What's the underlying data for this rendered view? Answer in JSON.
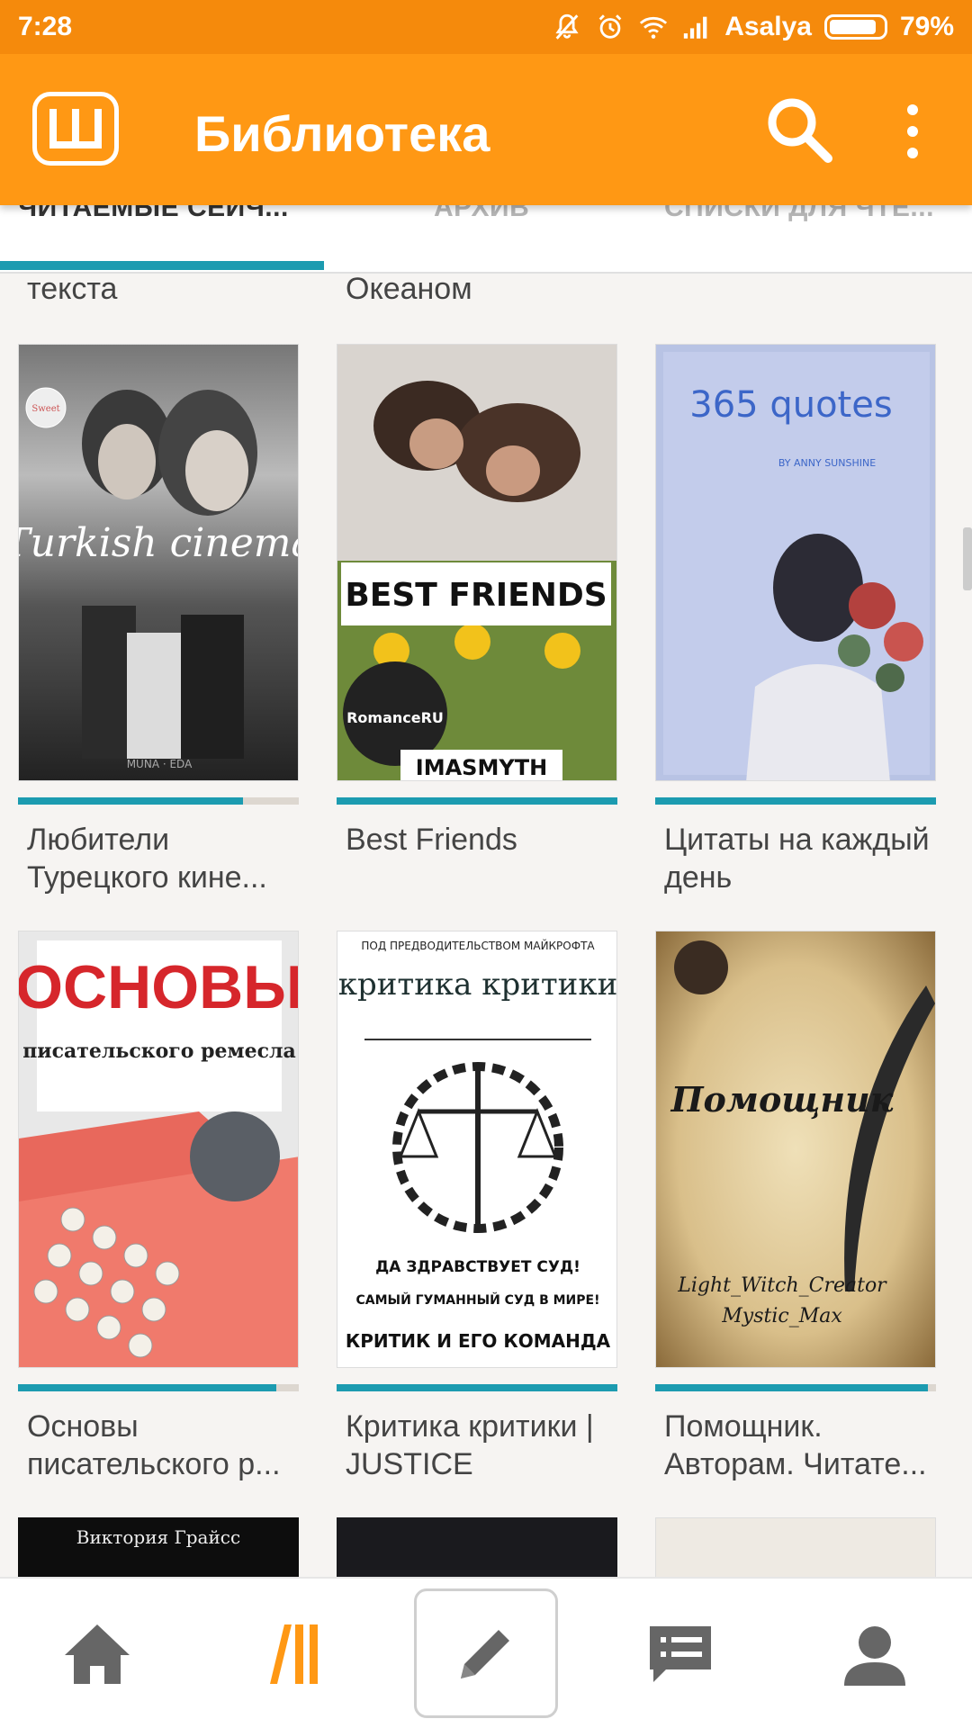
{
  "status_bar": {
    "time": "7:28",
    "carrier": "Asalya",
    "battery": "79%",
    "battery_level": 0.79
  },
  "app_bar": {
    "logo_letter": "Ш",
    "title": "Библиотека",
    "icons": [
      "search-icon",
      "more-vert-icon"
    ]
  },
  "tabs": [
    {
      "label": "ЧИТАЕМЫЕ СЕЙЧ...",
      "active": true
    },
    {
      "label": "АРХИВ",
      "active": false
    },
    {
      "label": "СПИСКИ ДЛЯ ЧТЕ...",
      "active": false
    }
  ],
  "partial_titles": [
    "текста",
    "Океаном"
  ],
  "stories": [
    {
      "title": "Любители Турецкого кине...",
      "progress": 0.8,
      "cover": {
        "text": "Turkish cinema",
        "bottom_text": "MUNA · EDA",
        "badge": "Sweet"
      }
    },
    {
      "title": "Best Friends",
      "progress": 1.0,
      "cover": {
        "text": "BEST FRIENDS",
        "badge": "RomanceRU",
        "bottom_text": "IMASMYTH"
      }
    },
    {
      "title": "Цитаты на каждый день",
      "progress": 1.0,
      "cover": {
        "text": "365 quotes",
        "subtext": "BY ANNY SUNSHINE"
      }
    },
    {
      "title": "Основы писательского р...",
      "progress": 0.92,
      "cover": {
        "text": "ОСНОВЫ",
        "subtext": "писательского ремесла"
      }
    },
    {
      "title": "Критика критики | JUSTICE",
      "progress": 1.0,
      "cover": {
        "top_text": "ПОД ПРЕДВОДИТЕЛЬСТВОМ МАЙКРОФТА",
        "text": "критика критики",
        "line1": "ДА ЗДРАВСТВУЕТ СУД!",
        "line2": "САМЫЙ ГУМАННЫЙ СУД В МИРЕ!",
        "line3": "КРИТИК И ЕГО КОМАНДА"
      }
    },
    {
      "title": "Помощник. Авторам. Читате...",
      "progress": 0.97,
      "cover": {
        "text": "Помощник",
        "line1": "Light_Witch_Creator",
        "line2": "Mystic_Max"
      }
    }
  ],
  "partial_covers": [
    {
      "text": "Виктория Грайсс"
    }
  ],
  "bottom_nav": [
    {
      "icon": "home-icon",
      "active": false
    },
    {
      "icon": "library-icon",
      "active": true
    },
    {
      "icon": "write-icon",
      "active": false
    },
    {
      "icon": "messages-icon",
      "active": false
    },
    {
      "icon": "profile-icon",
      "active": false
    }
  ],
  "colors": {
    "status_bar": "#f58a0c",
    "app_bar": "#ff9814",
    "accent": "#1c9bb0",
    "background": "#f6f4f2",
    "nav_icon": "#666666",
    "nav_active": "#ff9814"
  }
}
